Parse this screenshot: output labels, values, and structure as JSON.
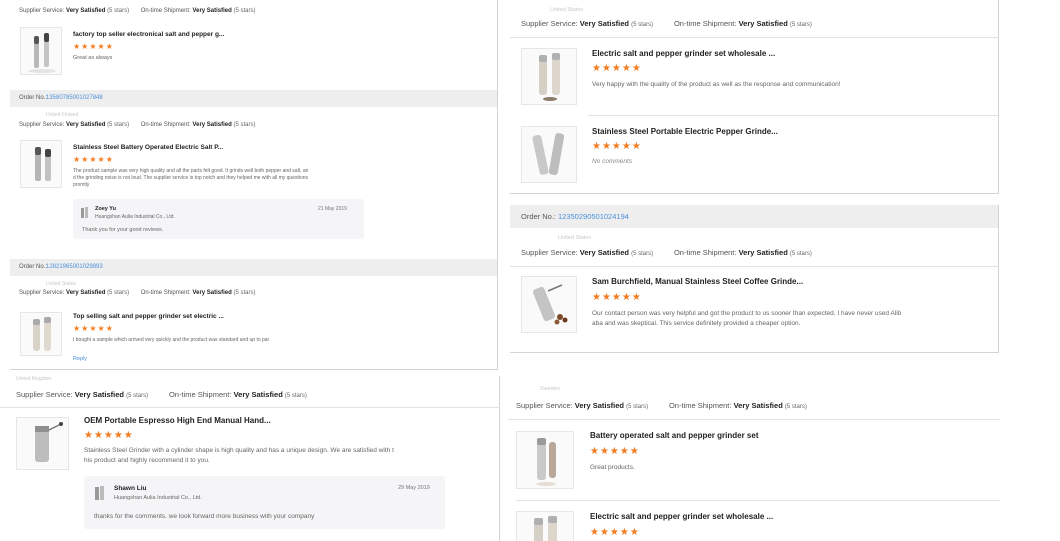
{
  "labels": {
    "order_no": "Order No.:",
    "supplier_service": "Supplier Service:",
    "ontime_shipment": "On-time Shipment:",
    "very_satisfied": "Very Satisfied",
    "five_stars": "(5 stars)",
    "stars": "★★★★★"
  },
  "colors": {
    "star": "#f47c20",
    "order_number": "#4a90d9",
    "order_bar_bg": "#eeeeee"
  },
  "panel_tl": {
    "product_1": {
      "title": "factory top seller electronical salt and pepper g...",
      "review": "Great as always"
    },
    "order_2": {
      "number": "13580785001027848",
      "buyer_blurred": "United Finland",
      "product_title": "Stainless Steel Battery Operated Electric Salt P...",
      "review_line_1": "The product sample was very high quality and all the parts felt good. It grinds well both pepper and salt, an",
      "review_line_2": "d the grinding noise is not loud. The supplier service is top notch and they helped me with all my questions",
      "review_line_3": "promtly",
      "reply": {
        "name": "Zoey Yu",
        "company": "Huangshan Aulia Industrial Co., Ltd.",
        "date": "21 May 2019",
        "message": "Thank you for your good reviews."
      }
    },
    "order_3": {
      "number": "12821965001029893",
      "buyer_blurred": "United States",
      "product_title": "Top selling salt and pepper grinder set electric ...",
      "review": "I bought a sample which arrived very quickly and the product was standard and up to par",
      "reply_link": "Reply"
    }
  },
  "panel_tr": {
    "buyer_blurred": "United States",
    "product_1": {
      "title": "Electric salt and pepper grinder set wholesale ...",
      "review": "Very happy with the quality of the product as well as the response and communication!"
    },
    "product_2": {
      "title": "Stainless Steel Portable Electric Pepper Grinde...",
      "review": "No comments"
    }
  },
  "panel_mr": {
    "number": "12350290501024194",
    "buyer_blurred": "United States",
    "product_title": "Sam Burchfield, Manual Stainless Steel Coffee Grinde...",
    "review_line_1": "Our contact person was very helpful and got the product to us sooner than expected. I have never used Alib",
    "review_line_2": "aba and was skeptical. This service definitely provided a cheaper option."
  },
  "panel_bl": {
    "buyer_blurred": "United Kingdom",
    "product_title": "OEM Portable Espresso High End Manual Hand...",
    "review_line_1": "Stainless Steel Grinder with a cylinder shape is high quality and has a unique design. We are satisfied with t",
    "review_line_2": "his product and highly recommend it to you.",
    "reply": {
      "name": "Shawn Liu",
      "company": "Huangshan Aulia Industrial Co., Ltd.",
      "date": "29 May 2019",
      "message": "thanks for the comments. we look forward more business with your company"
    }
  },
  "panel_br": {
    "buyer_blurred": "Sweden",
    "product_1": {
      "title": "Battery operated salt and pepper grinder set",
      "review": "Great products."
    },
    "product_2": {
      "title": "Electric salt and pepper grinder set wholesale ..."
    }
  }
}
